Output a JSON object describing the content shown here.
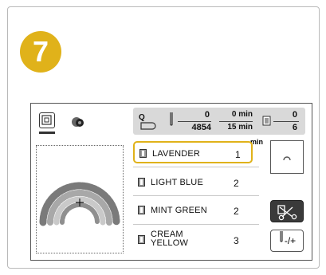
{
  "step": {
    "number": "7"
  },
  "infobar": {
    "stitch_current": "0",
    "stitch_total": "4854",
    "time_current": "0 min",
    "time_total": "15 min",
    "color_current": "0",
    "color_total": "6"
  },
  "colors": [
    {
      "name": "LAVENDER",
      "count": "1",
      "selected": true
    },
    {
      "name": "LIGHT BLUE",
      "count": "2",
      "selected": false
    },
    {
      "name": "MINT GREEN",
      "count": "2",
      "selected": false
    },
    {
      "name_line1": "CREAM",
      "name_line2": "YELLOW",
      "count": "3",
      "selected": false
    }
  ],
  "min_label": "min",
  "buttons": {
    "needle_label": "-/+"
  },
  "accent_color": "#e0b21a",
  "icons": [
    "embroidery-frame-icon",
    "thread-spool-icon",
    "presser-foot-icon",
    "needle-icon",
    "thread-cut-icon",
    "stitch-preview-icon"
  ]
}
